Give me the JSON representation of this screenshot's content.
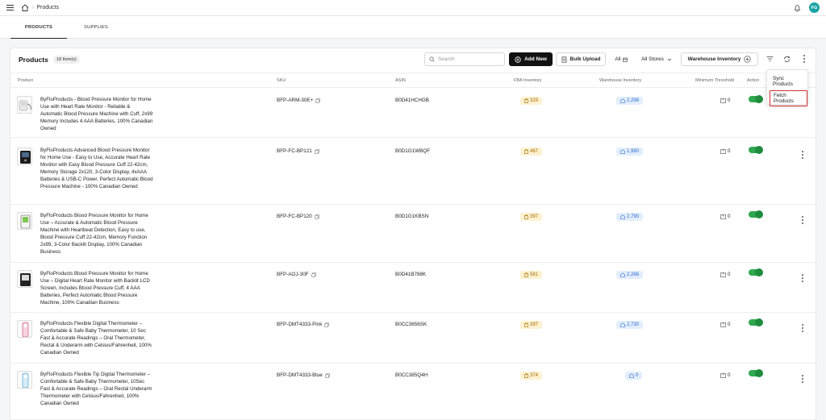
{
  "topbar": {
    "breadcrumb": "Products",
    "avatar_initials": "FG",
    "avatar_color": "#1aa3a3"
  },
  "tabs": [
    {
      "label": "PRODUCTS",
      "active": true
    },
    {
      "label": "SUPPLIES",
      "active": false
    }
  ],
  "header": {
    "title": "Products",
    "count": "18 Item(s)",
    "search_placeholder": "Search",
    "add_new": "Add New",
    "bulk_upload": "Bulk Upload",
    "all_filter": "All",
    "all_stores": "All Stores",
    "warehouse_inventory": "Warehouse Inventory"
  },
  "columns": {
    "product": "Product",
    "sku": "SKU",
    "asin": "ASIN",
    "fba": "FBA Inventory",
    "warehouse": "Warehouse Inventory",
    "min": "Minimum Threshold",
    "action": "Action"
  },
  "dropdown": {
    "sync": "Sync Products",
    "fetch": "Fetch Products"
  },
  "colors": {
    "accent_dark": "#111111",
    "toggle_on": "#2fa84f",
    "fba_bg": "#fdf1d0",
    "warehouse_bg": "#e3eefc",
    "highlight": "#d32f2f"
  },
  "rows": [
    {
      "name": "ByFloProducts - Blood Pressure Monitor for Home Use with Heart Rate Monitor - Reliable & Automatic Blood Pressure Machine with Cuff, 2x99 Memory Includes 4 AAA Batteries, 100% Canadian Owned",
      "sku": "BFP-ARM-30E+",
      "asin": "B0D41HCHGB",
      "fba": "329",
      "warehouse": "2,298",
      "min": "0",
      "enabled": true
    },
    {
      "name": "ByFloProducts Advanced Blood Pressure Monitor for Home Use - Easy to Use, Accurate Heart Rate Monitor with Easy Blood Pressure Cuff 22-42cm, Memory Storage 2x120, 3-Color Display, 4xAAA Batteries & USB-C Power, Perfect Automatic Blood Pressure Machine - 100% Canadian Owned",
      "sku": "BFP-FC-BP121",
      "asin": "B0D1G1WBQF",
      "fba": "467",
      "warehouse": "1,980",
      "min": "0",
      "enabled": true
    },
    {
      "name": "ByFloProducts Blood Pressure Monitor for Home Use – Accurate & Automatic Blood Pressure Machine with Heartbeat Detection, Easy to use, Blood Pressure Cuff 22-42cm, Memory Function 2x99, 3-Color Backlit Display, 100% Canadian Business",
      "sku": "BFP-FC-BP120",
      "asin": "B0D1G1KBSN",
      "fba": "397",
      "warehouse": "2,790",
      "min": "0",
      "enabled": true
    },
    {
      "name": "ByFloProducts Blood Pressure Monitor for Home Use – Digital Heart Rate Monitor with Backlit LCD Screen, Includes Blood Pressure Cuff, 4 AAA Batteries, Perfect Automatic Blood Pressure Machine, 100% Canadian Business",
      "sku": "BFP-AOJ-30F",
      "asin": "B0D41B788K",
      "fba": "581",
      "warehouse": "2,268",
      "min": "0",
      "enabled": true
    },
    {
      "name": "ByFloProducts Flexible Digital Thermometer – Comfortable & Safe Baby Thermometer, 10 Sec Fast & Accurate Readings – Oral Thermometer, Rectal & Underarm with Celsius/Fahrenheit, 100% Canadian Owned",
      "sku": "BFP-DMT4333-Pink",
      "asin": "B0CC3656SK",
      "fba": "397",
      "warehouse": "2,730",
      "min": "0",
      "enabled": true
    },
    {
      "name": "ByFloProducts Flexible Tip Digital Thermometer – Comfortable & Safe Baby Thermometer, 10Sec Fast & Accurate Readings – Oral Rectal Underarm Thermometer with Celsius/Fahrenheit, 100% Canadian Owned",
      "sku": "BFP-DMT4333-Blue",
      "asin": "B0CC385Q4H",
      "fba": "374",
      "warehouse": "0",
      "min": "0",
      "enabled": true
    }
  ]
}
